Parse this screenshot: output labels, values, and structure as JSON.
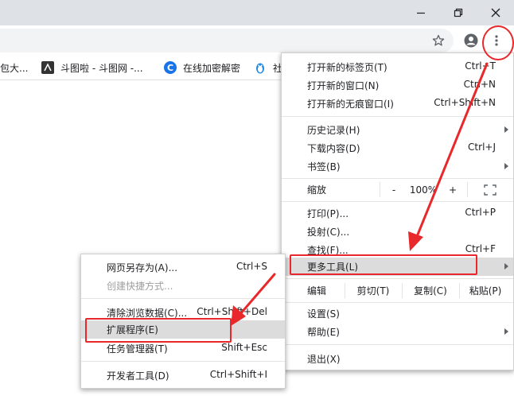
{
  "bookmarks": [
    {
      "label": "包大...",
      "icon": "bookmark-icon"
    },
    {
      "label": "斗图啦 - 斗图网 -...",
      "icon": "doutula-icon"
    },
    {
      "label": "在线加密解密",
      "icon": "c-logo-icon"
    },
    {
      "label": "社",
      "icon": "penguin-icon"
    }
  ],
  "main_menu": {
    "new_tab": {
      "label": "打开新的标签页(T)",
      "shortcut": "Ctrl+T"
    },
    "new_window": {
      "label": "打开新的窗口(N)",
      "shortcut": "Ctrl+N"
    },
    "incognito": {
      "label": "打开新的无痕窗口(I)",
      "shortcut": "Ctrl+Shift+N"
    },
    "history": {
      "label": "历史记录(H)"
    },
    "downloads": {
      "label": "下载内容(D)",
      "shortcut": "Ctrl+J"
    },
    "bookmarks": {
      "label": "书签(B)"
    },
    "zoom": {
      "label": "缩放",
      "minus": "-",
      "value": "100%",
      "plus": "+"
    },
    "print": {
      "label": "打印(P)...",
      "shortcut": "Ctrl+P"
    },
    "cast": {
      "label": "投射(C)..."
    },
    "find": {
      "label": "查找(F)...",
      "shortcut": "Ctrl+F"
    },
    "more_tools": {
      "label": "更多工具(L)"
    },
    "edit": {
      "label": "编辑",
      "cut": "剪切(T)",
      "copy": "复制(C)",
      "paste": "粘贴(P)"
    },
    "settings": {
      "label": "设置(S)"
    },
    "help": {
      "label": "帮助(E)"
    },
    "exit": {
      "label": "退出(X)"
    }
  },
  "sub_menu": {
    "save_page": {
      "label": "网页另存为(A)...",
      "shortcut": "Ctrl+S"
    },
    "create_shortcut": {
      "label": "创建快捷方式..."
    },
    "clear_data": {
      "label": "清除浏览数据(C)...",
      "shortcut": "Ctrl+Shift+Del"
    },
    "extensions": {
      "label": "扩展程序(E)"
    },
    "task_manager": {
      "label": "任务管理器(T)",
      "shortcut": "Shift+Esc"
    },
    "dev_tools": {
      "label": "开发者工具(D)",
      "shortcut": "Ctrl+Shift+I"
    }
  },
  "colors": {
    "annotation": "#e8282b",
    "highlight": "#dcdcdc",
    "titlebar": "#dee1e6"
  }
}
